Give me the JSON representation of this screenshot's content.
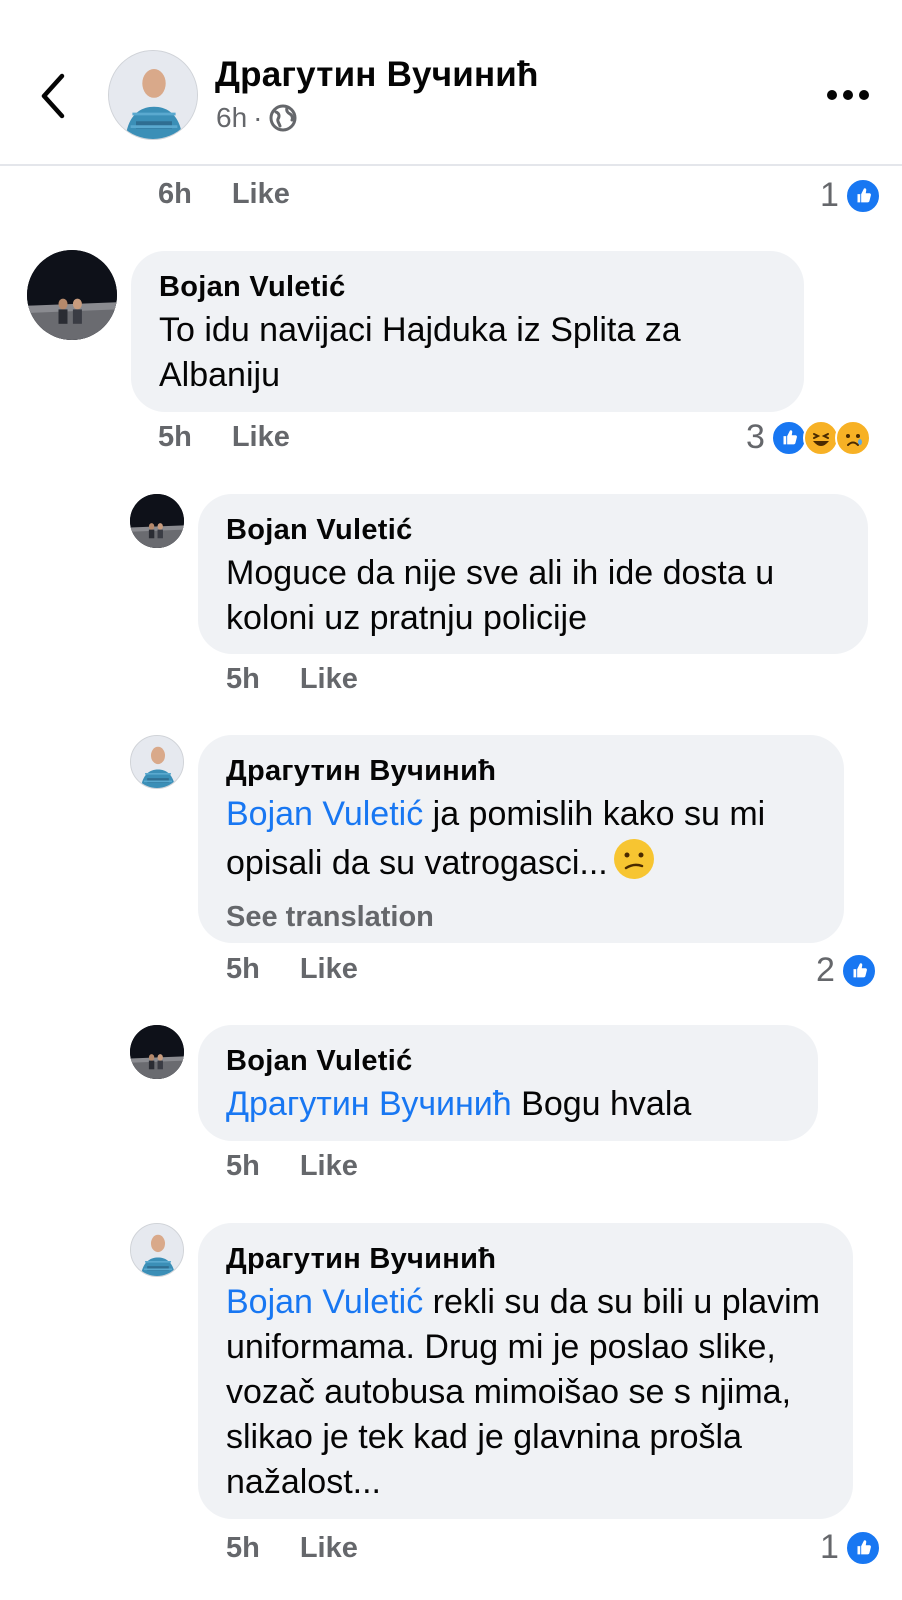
{
  "header": {
    "name": "Драгутин Вучинић",
    "time": "6h",
    "separator": "·"
  },
  "prev_comment": {
    "time": "6h",
    "like_label": "Like",
    "reaction_count": "1"
  },
  "comments": [
    {
      "author": "Bojan Vuletić",
      "text": "To idu navijaci Hajduka iz Splita za Albaniju",
      "time": "5h",
      "like_label": "Like",
      "reaction_count": "3"
    },
    {
      "author": "Bojan Vuletić",
      "text": "Moguce da nije sve ali ih ide dosta u koloni uz pratnju policije",
      "time": "5h",
      "like_label": "Like"
    },
    {
      "author": "Драгутин Вучинић",
      "mention": "Bojan Vuletić",
      "text": " ja pomislih kako su mi opisali da su vatrogasci...",
      "see_translation": "See translation",
      "time": "5h",
      "like_label": "Like",
      "reaction_count": "2"
    },
    {
      "author": "Bojan Vuletić",
      "mention": "Драгутин Вучинић",
      "text": " Bogu hvala",
      "time": "5h",
      "like_label": "Like"
    },
    {
      "author": "Драгутин Вучинић",
      "mention": "Bojan Vuletić",
      "text": " rekli su da su bili u plavim uniformama. Drug mi je poslao slike, vozač autobusa mimoišao se s njima, slikao je tek kad je glavnina prošla nažalost...",
      "time": "5h",
      "like_label": "Like",
      "reaction_count": "1"
    }
  ],
  "colors": {
    "accent": "#1877f2",
    "bubble": "#f0f2f5",
    "meta": "#65676b"
  }
}
